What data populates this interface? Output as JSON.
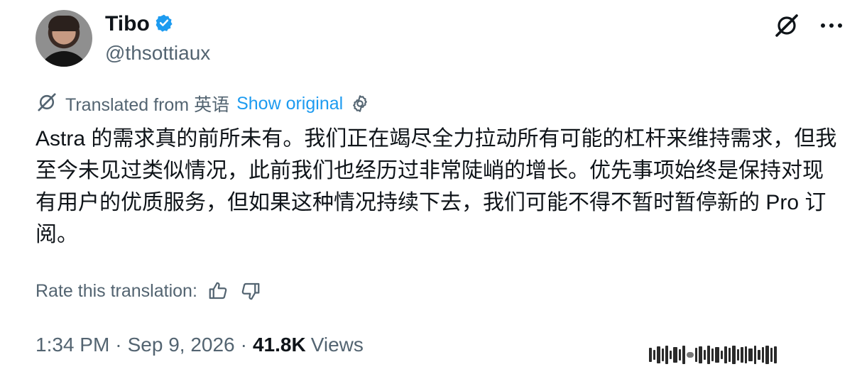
{
  "author": {
    "name": "Tibo",
    "handle": "@thsottiaux"
  },
  "translation": {
    "translated_from": "Translated from 英语",
    "show_original": "Show original"
  },
  "tweet": {
    "text": "Astra 的需求真的前所未有。我们正在竭尽全力拉动所有可能的杠杆来维持需求，但我至今未见过类似情况，此前我们也经历过非常陡峭的增长。优先事项始终是保持对现有用户的优质服务，但如果这种情况持续下去，我们可能不得不暂时暂停新的 Pro 订阅。"
  },
  "rating": {
    "label": "Rate this translation:"
  },
  "meta": {
    "time": "1:34 PM",
    "separator": "·",
    "date": "Sep 9, 2026",
    "views_count": "41.8K",
    "views_label": "Views"
  },
  "colors": {
    "text": "#0f1419",
    "secondary": "#536471",
    "link": "#1d9bf0",
    "verified": "#1d9bf0"
  }
}
